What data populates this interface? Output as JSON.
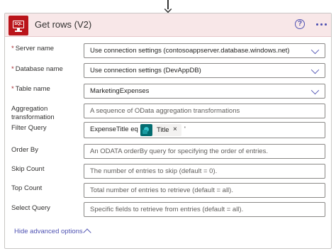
{
  "header": {
    "title": "Get rows (V2)",
    "icon_text": "SQL",
    "help_symbol": "?",
    "brand_color": "#ba141a"
  },
  "fields": {
    "server": {
      "label": "Server name",
      "value": "Use connection settings (contosoappserver.database.windows.net)",
      "required": true
    },
    "database": {
      "label": "Database name",
      "value": "Use connection settings (DevAppDB)",
      "required": true
    },
    "table": {
      "label": "Table name",
      "value": "MarketingExpenses",
      "required": true
    },
    "aggregation": {
      "label": "Aggregation transformation",
      "placeholder": "A sequence of OData aggregation transformations"
    },
    "filter": {
      "label": "Filter Query",
      "prefix": "ExpenseTitle eq '",
      "token_label": "Title",
      "token_close": "×",
      "suffix": "'"
    },
    "order_by": {
      "label": "Order By",
      "placeholder": "An ODATA orderBy query for specifying the order of entries."
    },
    "skip": {
      "label": "Skip Count",
      "placeholder": "The number of entries to skip (default = 0)."
    },
    "top": {
      "label": "Top Count",
      "placeholder": "Total number of entries to retrieve (default = all)."
    },
    "select": {
      "label": "Select Query",
      "placeholder": "Specific fields to retrieve from entries (default = all)."
    }
  },
  "advanced": {
    "label": "Hide advanced options"
  },
  "required_mark": "*"
}
